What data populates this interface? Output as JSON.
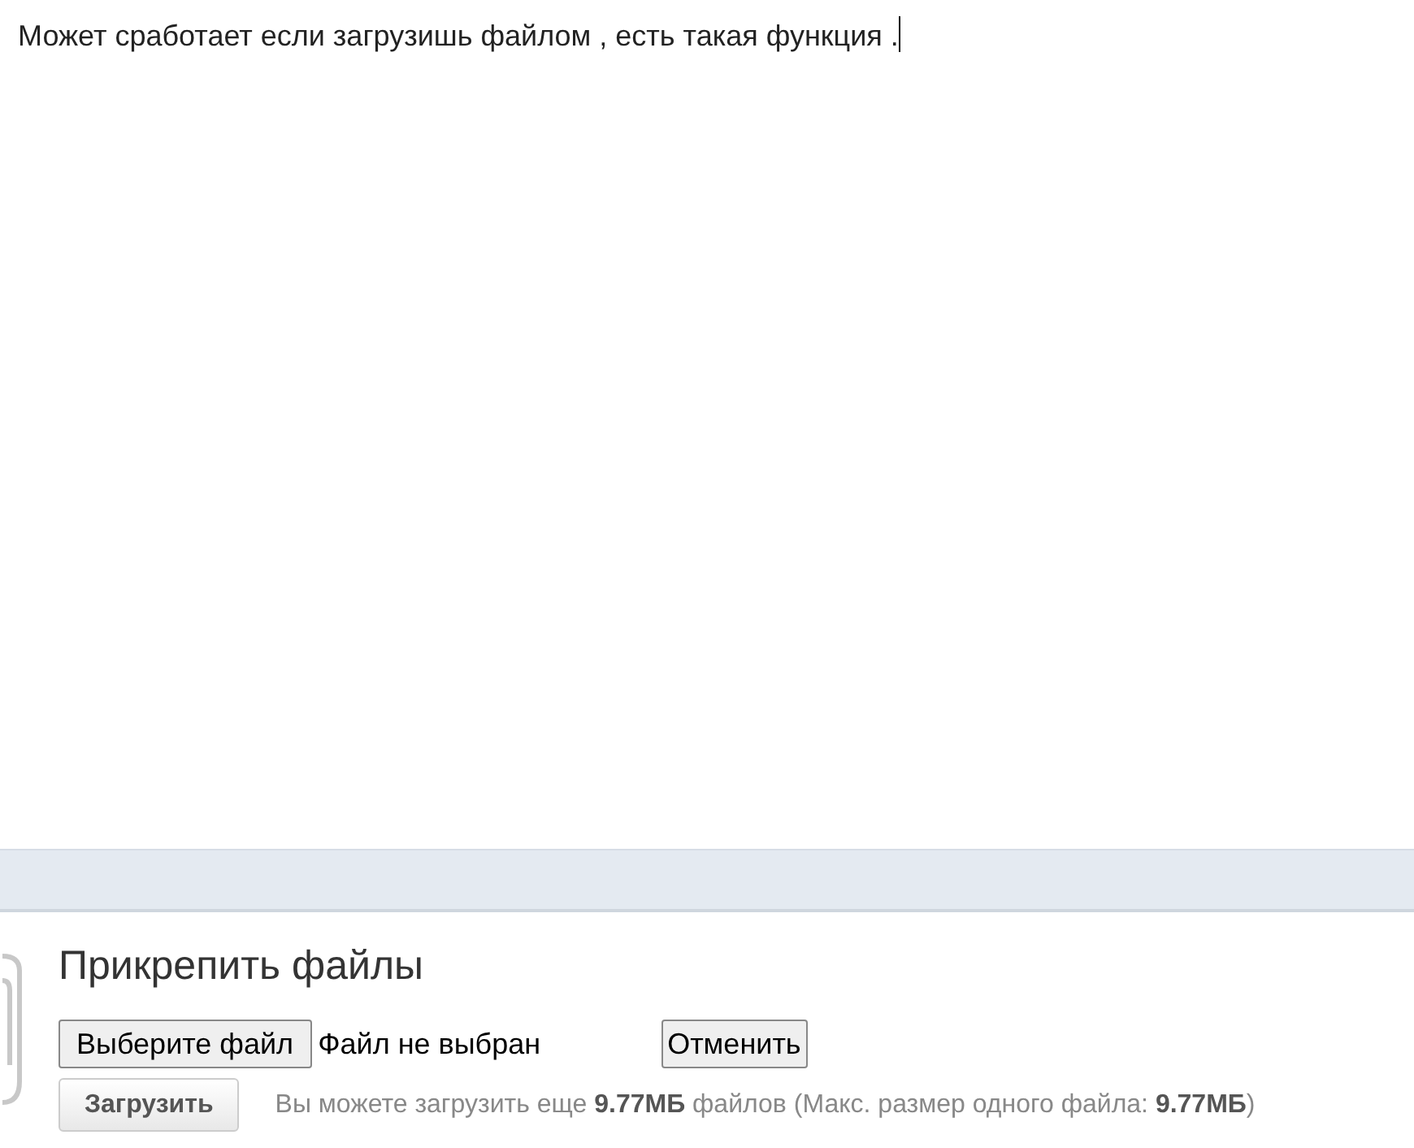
{
  "editor": {
    "text": "Может сработает если загрузишь файлом , есть такая функция ."
  },
  "attachments": {
    "title": "Прикрепить файлы",
    "choose_button": "Выберите файл",
    "file_status": "Файл не выбран",
    "cancel_button": "Отменить",
    "upload_button": "Загрузить",
    "info": "Вы можете загрузить еще **9.77МБ** файлов (Макс. размер одного файла: **9.77МБ**)"
  }
}
